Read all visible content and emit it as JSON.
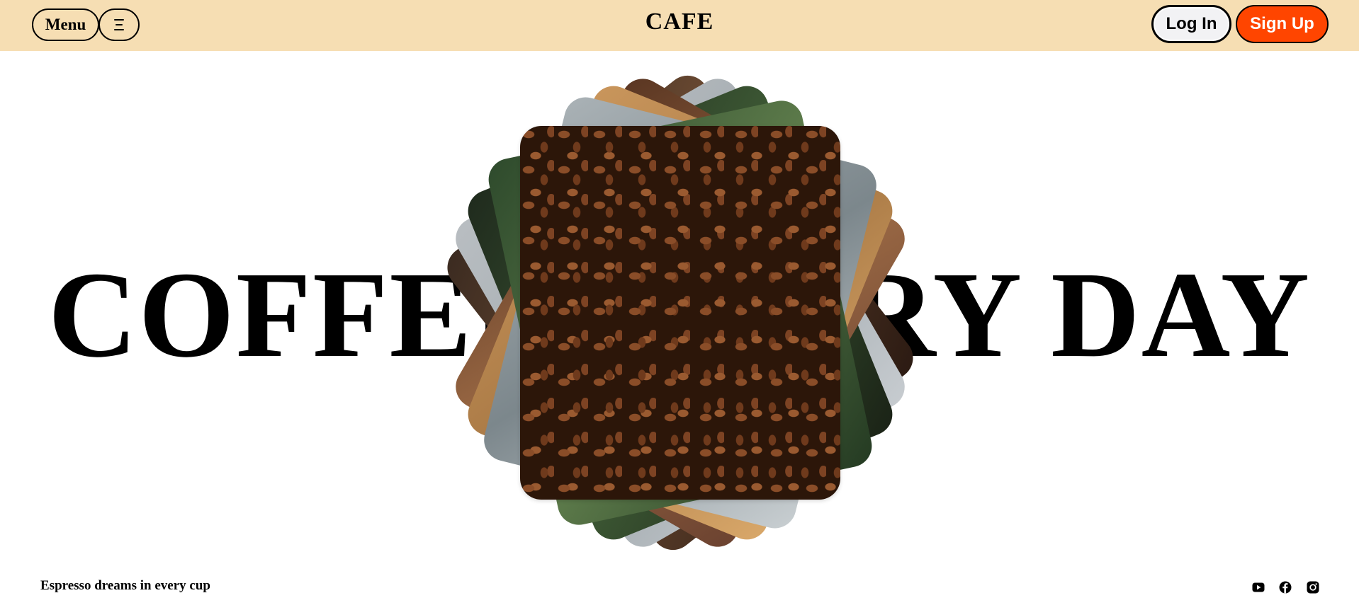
{
  "header": {
    "menu_label": "Menu",
    "brand": "CAFE",
    "login_label": "Log In",
    "signup_label": "Sign Up"
  },
  "hero": {
    "headline": "COFFEE EVERY DAY",
    "image_icon": "coffee-beans-image",
    "stack_icons": [
      "coffee-photo-card",
      "coffee-photo-card",
      "coffee-photo-card",
      "coffee-photo-card",
      "coffee-photo-card",
      "coffee-photo-card",
      "coffee-photo-card"
    ]
  },
  "footer": {
    "tagline": "Espresso dreams in every cup",
    "social": [
      "youtube-icon",
      "facebook-icon",
      "instagram-icon"
    ]
  },
  "colors": {
    "header_bg": "#f6deb3",
    "signup_bg": "#ff4500",
    "login_bg": "#f2f2f4"
  }
}
